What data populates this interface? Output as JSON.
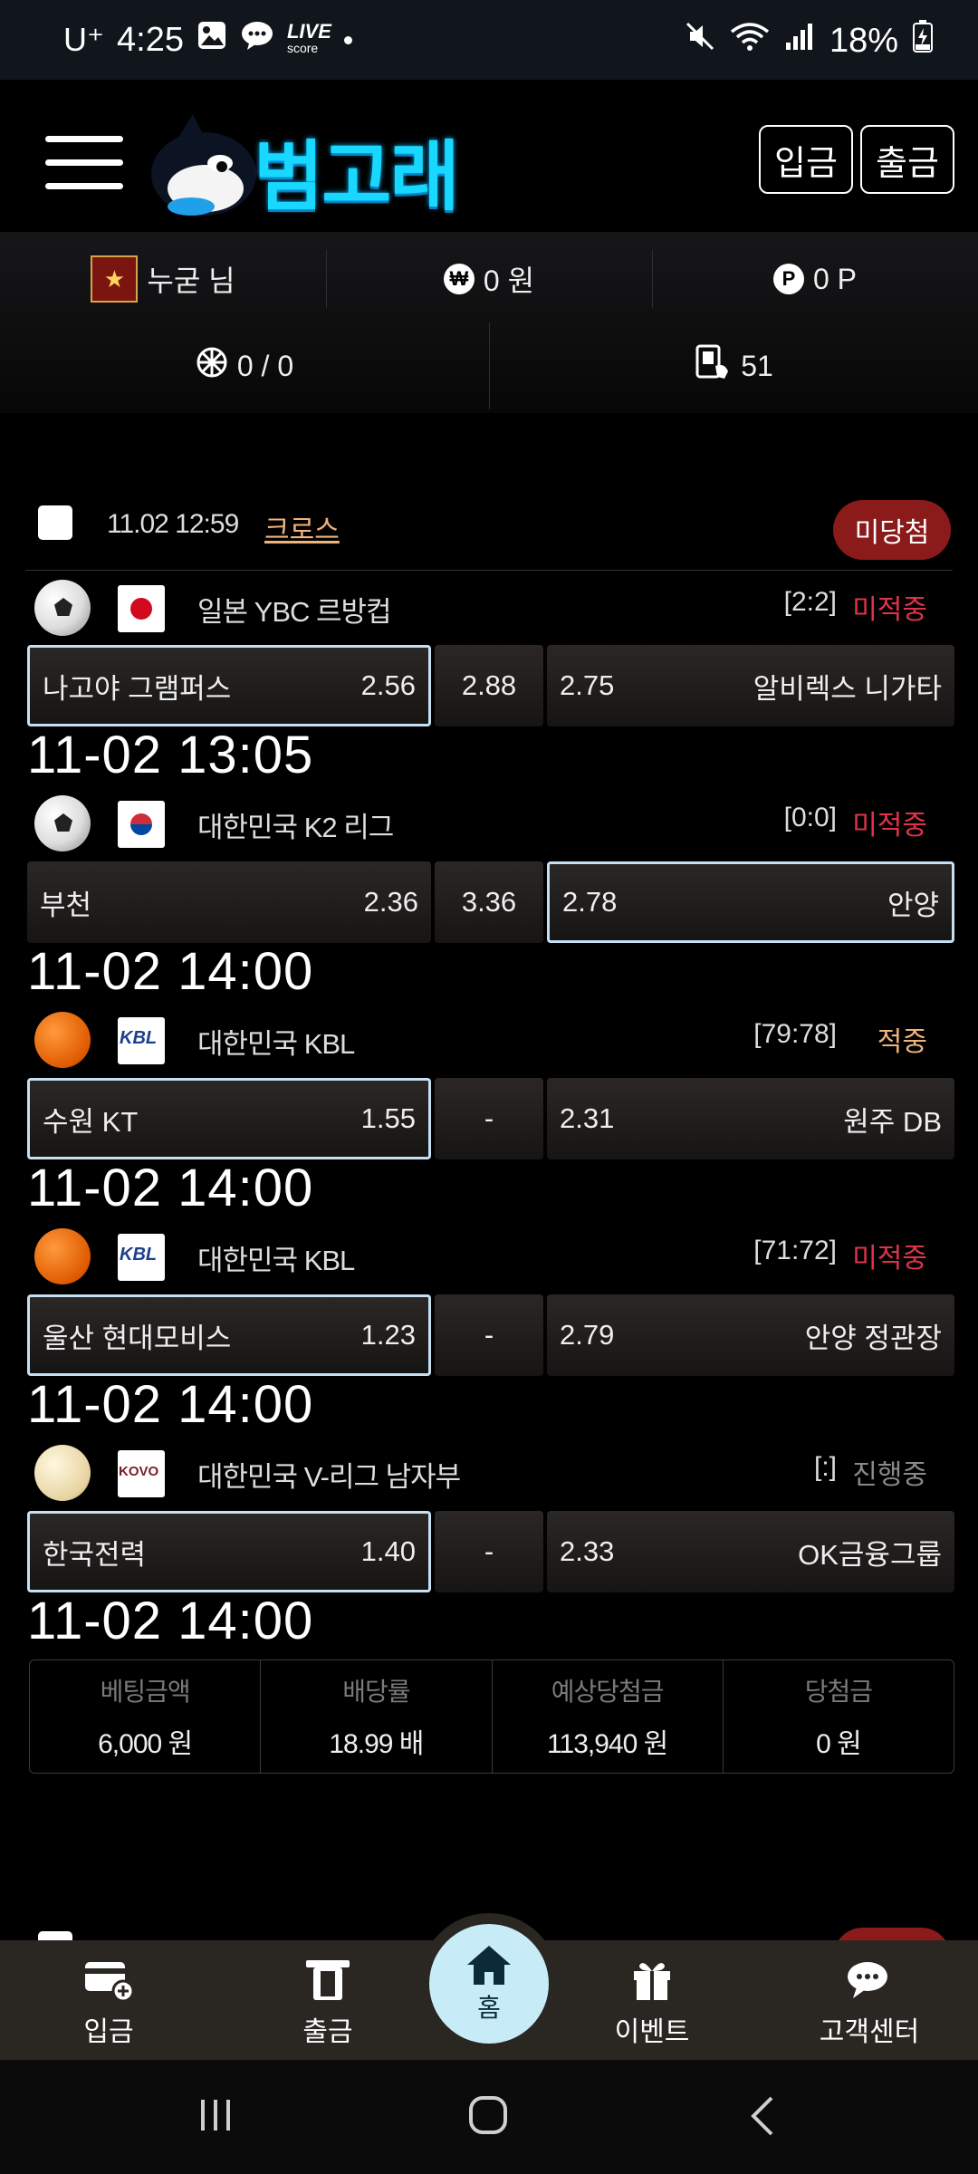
{
  "status_bar": {
    "carrier": "U⁺",
    "time": "4:25",
    "live_line1": "LIVE",
    "live_line2": "score",
    "battery": "18%"
  },
  "header": {
    "logo_text": "범고래",
    "deposit_label": "입금",
    "withdraw_label": "출금"
  },
  "user": {
    "name": "누굳 님",
    "money": "0 원",
    "points": "0 P",
    "wheel": "0 / 0",
    "coupons": "51"
  },
  "bet": {
    "date": "11.02 12:59",
    "type": "크로스",
    "status": "미당첨",
    "matches": [
      {
        "sport": "soccer",
        "flag": "jp",
        "league": "일본 YBC 르방컵",
        "score": "[2:2]",
        "result": "미적중",
        "result_color": "#e0334a",
        "home": "나고야 그램퍼스",
        "home_odds": "2.56",
        "draw": "2.88",
        "away_odds": "2.75",
        "away": "알비렉스 니가타",
        "selected": "home",
        "time": "11-02 13:05"
      },
      {
        "sport": "soccer",
        "flag": "kr",
        "league": "대한민국 K2 리그",
        "score": "[0:0]",
        "result": "미적중",
        "result_color": "#e0334a",
        "home": "부천",
        "home_odds": "2.36",
        "draw": "3.36",
        "away_odds": "2.78",
        "away": "안양",
        "selected": "away",
        "time": "11-02 14:00"
      },
      {
        "sport": "basket",
        "flag": "kbl",
        "league": "대한민국 KBL",
        "score": "[79:78]",
        "result": "적중",
        "result_color": "#f0b37a",
        "home": "수원 KT",
        "home_odds": "1.55",
        "draw": "-",
        "away_odds": "2.31",
        "away": "원주 DB",
        "selected": "home",
        "time": "11-02 14:00"
      },
      {
        "sport": "basket",
        "flag": "kbl",
        "league": "대한민국 KBL",
        "score": "[71:72]",
        "result": "미적중",
        "result_color": "#e0334a",
        "home": "울산 현대모비스",
        "home_odds": "1.23",
        "draw": "-",
        "away_odds": "2.79",
        "away": "안양 정관장",
        "selected": "home",
        "time": "11-02 14:00"
      },
      {
        "sport": "volley",
        "flag": "kovo",
        "league": "대한민국 V-리그 남자부",
        "score": "[:]",
        "result": "진행중",
        "result_color": "#8a8a8a",
        "home": "한국전력",
        "home_odds": "1.40",
        "draw": "-",
        "away_odds": "2.33",
        "away": "OK금융그룹",
        "selected": "home",
        "time": "11-02 14:00"
      }
    ],
    "summary": [
      {
        "label": "베팅금액",
        "value": "6,000 원"
      },
      {
        "label": "배당률",
        "value": "18.99 배"
      },
      {
        "label": "예상당첨금",
        "value": "113,940 원"
      },
      {
        "label": "당첨금",
        "value": "0 원"
      }
    ]
  },
  "bottom_nav": {
    "deposit": "입금",
    "withdraw": "출금",
    "home": "홈",
    "event": "이벤트",
    "support": "고객센터"
  },
  "colors": {
    "accent_cyan": "#19d8ff",
    "lose_red": "#e0334a",
    "win_gold": "#f0b37a",
    "status_pill": "#8b1a1a",
    "selected_border": "#c4e0f2"
  }
}
